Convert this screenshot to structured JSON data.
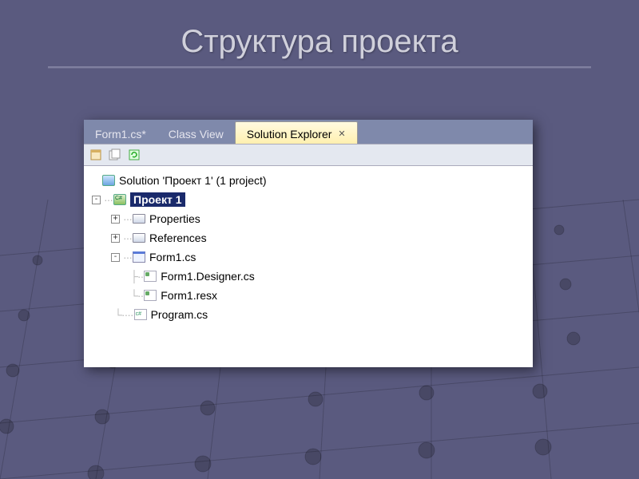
{
  "slide": {
    "title": "Структура проекта"
  },
  "tabs": {
    "form_tab": "Form1.cs*",
    "class_view": "Class View",
    "solution_explorer": "Solution Explorer"
  },
  "tree": {
    "solution": "Solution 'Проект 1' (1 project)",
    "project": "Проект 1",
    "properties": "Properties",
    "references": "References",
    "form1": "Form1.cs",
    "form1_designer": "Form1.Designer.cs",
    "form1_resx": "Form1.resx",
    "program": "Program.cs"
  }
}
